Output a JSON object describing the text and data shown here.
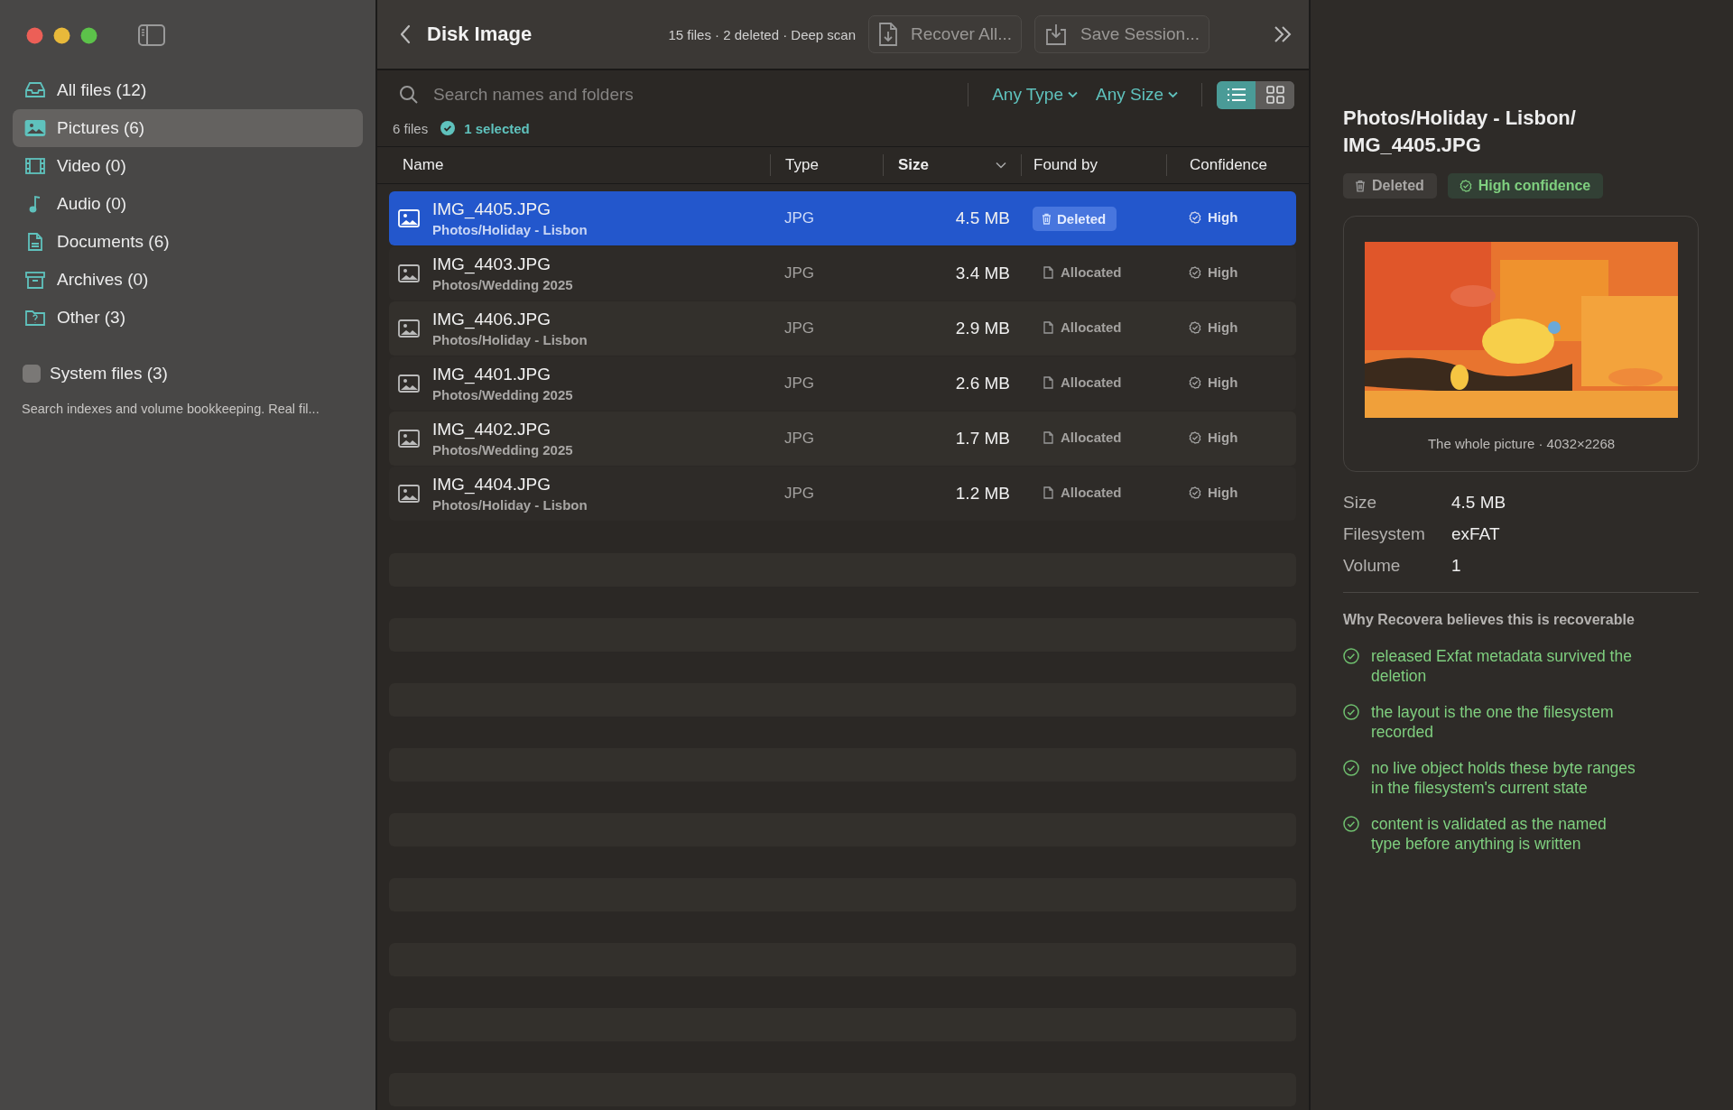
{
  "sidebar": {
    "items": [
      {
        "label": "All files (12)",
        "kind": "tray",
        "selected": false
      },
      {
        "label": "Pictures (6)",
        "selected": true
      },
      {
        "label": "Video (0)",
        "kind": "film",
        "selected": false
      },
      {
        "label": "Audio (0)",
        "kind": "note",
        "selected": false
      },
      {
        "label": "Documents (6)",
        "kind": "doc",
        "selected": false
      },
      {
        "label": "Archives (0)",
        "kind": "archive",
        "selected": false
      },
      {
        "label": "Other (3)",
        "kind": "folder",
        "selected": false
      }
    ],
    "system_files": {
      "label": "System files (3)",
      "checked": false
    },
    "note": "Search indexes and volume bookkeeping. Real fil..."
  },
  "toolbar": {
    "title": "Disk Image",
    "summary": "15 files · 2 deleted · Deep scan",
    "buttons": [
      {
        "label": "Recover All...",
        "kind": "recover"
      },
      {
        "label": "Save Session...",
        "kind": "save"
      }
    ]
  },
  "search": {
    "placeholder": "Search names and folders"
  },
  "filters": [
    {
      "label": "Any Type"
    },
    {
      "label": "Any Size"
    }
  ],
  "view_modes": [
    {
      "kind": "list",
      "selected": true
    },
    {
      "kind": "grid",
      "selected": false
    }
  ],
  "file_count": "6 files",
  "selection_count": "1 selected",
  "table": {
    "columns": [
      {
        "label": "Name",
        "sorted": false
      },
      {
        "label": "Type",
        "sorted": false
      },
      {
        "label": "Size",
        "sorted": true
      },
      {
        "label": "Found by",
        "sorted": false
      },
      {
        "label": "Confidence",
        "sorted": false
      }
    ],
    "rows": [
      {
        "name": "IMG_4405.JPG",
        "path": "Photos/Holiday - Lisbon",
        "type": "JPG",
        "size": "4.5 MB",
        "found_by": "Deleted",
        "kind": "deleted",
        "confidence": "High",
        "selected": true
      },
      {
        "name": "IMG_4403.JPG",
        "path": "Photos/Wedding 2025",
        "type": "JPG",
        "size": "3.4 MB",
        "found_by": "Allocated",
        "kind": "allocated",
        "confidence": "High",
        "selected": false
      },
      {
        "name": "IMG_4406.JPG",
        "path": "Photos/Holiday - Lisbon",
        "type": "JPG",
        "size": "2.9 MB",
        "found_by": "Allocated",
        "kind": "allocated",
        "confidence": "High",
        "selected": false
      },
      {
        "name": "IMG_4401.JPG",
        "path": "Photos/Wedding 2025",
        "type": "JPG",
        "size": "2.6 MB",
        "found_by": "Allocated",
        "kind": "allocated",
        "confidence": "High",
        "selected": false
      },
      {
        "name": "IMG_4402.JPG",
        "path": "Photos/Wedding 2025",
        "type": "JPG",
        "size": "1.7 MB",
        "found_by": "Allocated",
        "kind": "allocated",
        "confidence": "High",
        "selected": false
      },
      {
        "name": "IMG_4404.JPG",
        "path": "Photos/Holiday - Lisbon",
        "type": "JPG",
        "size": "1.2 MB",
        "found_by": "Allocated",
        "kind": "allocated",
        "confidence": "High",
        "selected": false
      }
    ]
  },
  "details": {
    "folder": "Photos/Holiday - Lisbon/",
    "file": "IMG_4405.JPG",
    "badges": [
      {
        "label": "Deleted",
        "kind": "deleted"
      },
      {
        "label": "High confidence",
        "kind": "confidence"
      }
    ],
    "preview": {
      "kind": "picture",
      "caption": "The whole picture · 4032×2268"
    },
    "properties": [
      {
        "label": "Size",
        "value": "4.5 MB"
      },
      {
        "label": "Filesystem",
        "value": "exFAT"
      },
      {
        "label": "Volume",
        "value": "1"
      }
    ],
    "reasons_heading": "Why Recovera believes this is recoverable",
    "reasons": [
      "released Exfat metadata survived the deletion",
      "the layout is the one the filesystem recorded",
      "no live object holds these byte ranges in the filesystem's current state",
      "content is validated as the named type before anything is written"
    ]
  }
}
